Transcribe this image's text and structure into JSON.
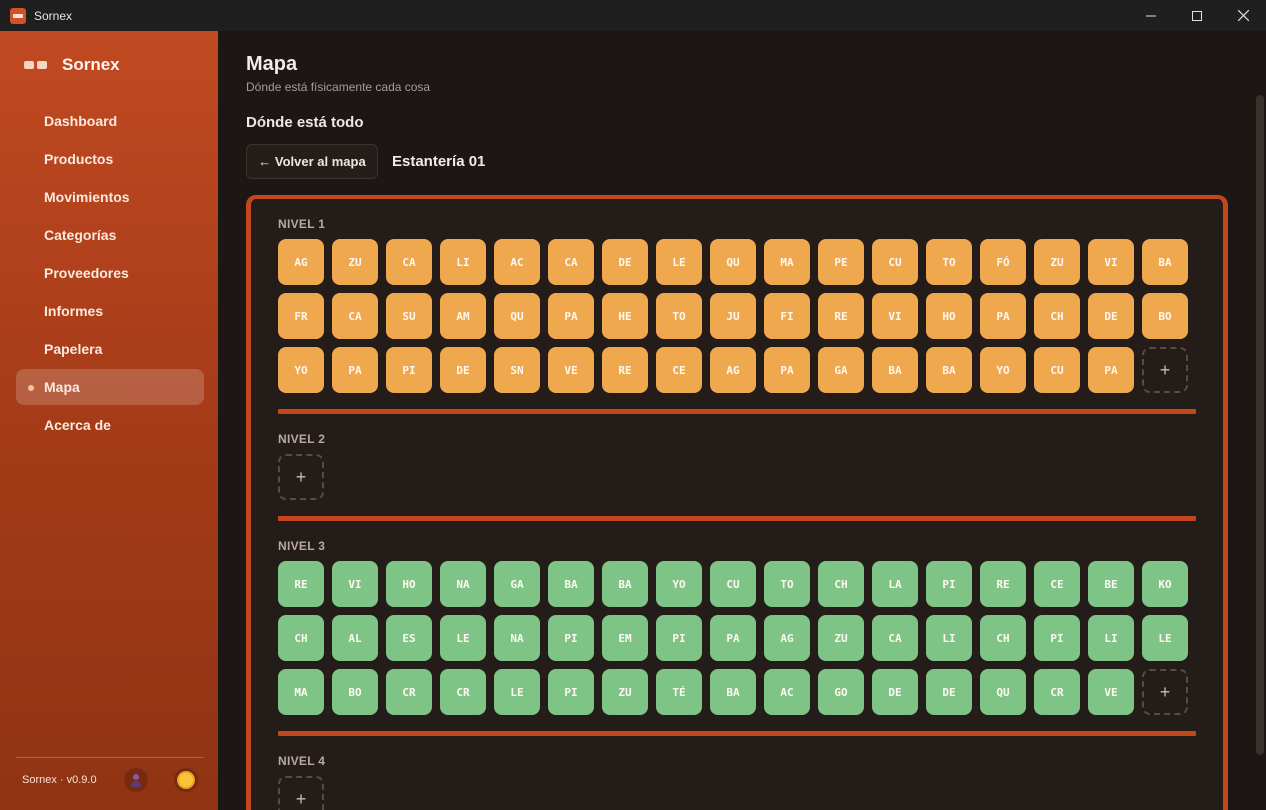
{
  "window": {
    "title": "Sornex"
  },
  "sidebar": {
    "brand": "Sornex",
    "items": [
      {
        "label": "Dashboard",
        "active": false
      },
      {
        "label": "Productos",
        "active": false
      },
      {
        "label": "Movimientos",
        "active": false
      },
      {
        "label": "Categorías",
        "active": false
      },
      {
        "label": "Proveedores",
        "active": false
      },
      {
        "label": "Informes",
        "active": false
      },
      {
        "label": "Papelera",
        "active": false
      },
      {
        "label": "Mapa",
        "active": true
      },
      {
        "label": "Acerca de",
        "active": false
      }
    ],
    "version": "Sornex · v0.9.0",
    "icons": [
      "user-avatar-icon",
      "sun-theme-icon"
    ]
  },
  "main": {
    "title": "Mapa",
    "subtitle": "Dónde está físicamente cada cosa",
    "section_title": "Dónde está todo",
    "back_label": "← Volver al mapa",
    "shelf_title": "Estantería 01"
  },
  "colors": {
    "accent": "#c4461c",
    "tile_orange": "#f0a84f",
    "tile_green": "#7ec487"
  },
  "levels": [
    {
      "label": "NIVEL 1",
      "color": "orange",
      "rows": [
        [
          "AG",
          "ZU",
          "CA",
          "LI",
          "AC",
          "CA",
          "DE",
          "LE",
          "QU",
          "MA",
          "PE",
          "CU",
          "TO",
          "FÓ",
          "ZU",
          "VI",
          "BA"
        ],
        [
          "FR",
          "CA",
          "SU",
          "AM",
          "QU",
          "PA",
          "HE",
          "TO",
          "JU",
          "FI",
          "RE",
          "VI",
          "HO",
          "PA",
          "CH",
          "DE",
          "BO"
        ],
        [
          "YO",
          "PA",
          "PI",
          "DE",
          "SN",
          "VE",
          "RE",
          "CE",
          "AG",
          "PA",
          "GA",
          "BA",
          "BA",
          "YO",
          "CU",
          "PA"
        ]
      ]
    },
    {
      "label": "NIVEL 2",
      "color": "orange",
      "rows": [
        []
      ]
    },
    {
      "label": "NIVEL 3",
      "color": "green",
      "rows": [
        [
          "RE",
          "VI",
          "HO",
          "NA",
          "GA",
          "BA",
          "BA",
          "YO",
          "CU",
          "TO",
          "CH",
          "LA",
          "PI",
          "RE",
          "CE",
          "BE",
          "KO"
        ],
        [
          "CH",
          "AL",
          "ES",
          "LE",
          "NA",
          "PI",
          "EM",
          "PI",
          "PA",
          "AG",
          "ZU",
          "CA",
          "LI",
          "CH",
          "PI",
          "LI",
          "LE"
        ],
        [
          "MA",
          "BO",
          "CR",
          "CR",
          "LE",
          "PI",
          "ZU",
          "TÉ",
          "BA",
          "AC",
          "GO",
          "DE",
          "DE",
          "QU",
          "CR",
          "VE"
        ]
      ]
    },
    {
      "label": "NIVEL 4",
      "color": "orange",
      "rows": [
        []
      ]
    }
  ],
  "add_label": "+"
}
